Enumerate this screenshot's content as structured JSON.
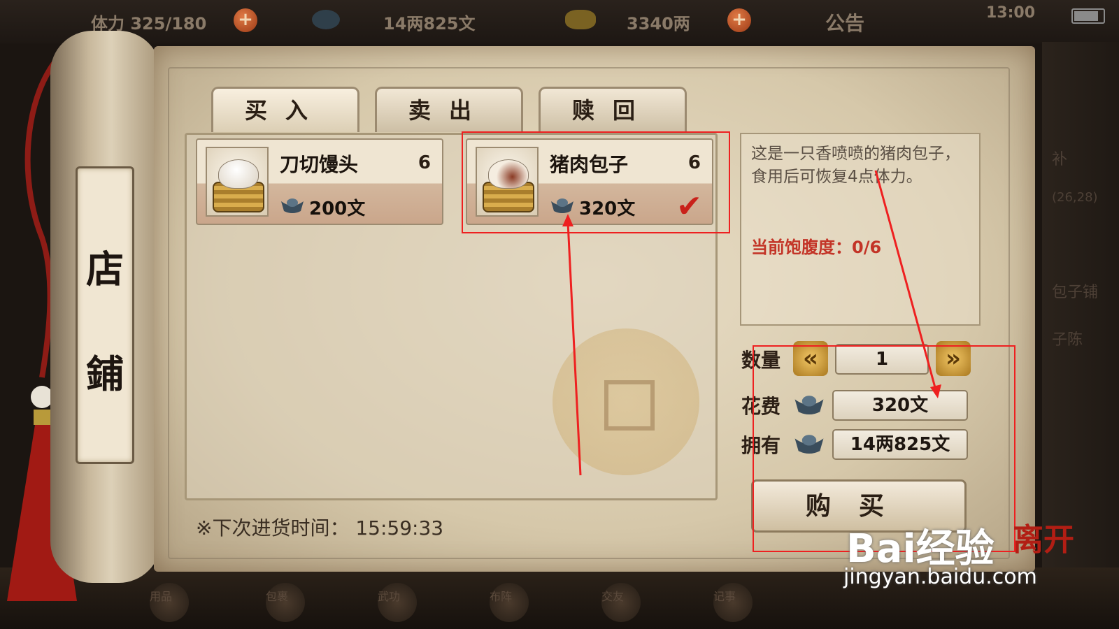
{
  "status_bar": {
    "stamina": "体力 325/180",
    "silver": "14两825文",
    "gold": "3340两",
    "notice": "公告",
    "time": "13:00"
  },
  "scroll": {
    "title_1": "店",
    "title_2": "鋪"
  },
  "tabs": [
    {
      "label": "买入"
    },
    {
      "label": "卖出"
    },
    {
      "label": "赎回"
    }
  ],
  "items": [
    {
      "name": "刀切馒头",
      "count": "6",
      "price": "200文"
    },
    {
      "name": "猪肉包子",
      "count": "6",
      "price": "320文",
      "selected": true
    }
  ],
  "description": {
    "text": "这是一只香喷喷的猪肉包子，食用后可恢复4点体力。",
    "satiety": "当前饱腹度：0/6"
  },
  "purchase": {
    "quantity_label": "数量",
    "quantity": "1",
    "cost_label": "花费",
    "cost": "320文",
    "owned_label": "拥有",
    "owned": "14两825文",
    "buy_label": "购买"
  },
  "restock": "※下次进货时间：  15:59:33",
  "right_strip": [
    "补",
    "(26,28)",
    "包子铺",
    "子陈"
  ],
  "bottom_icons": [
    "用品",
    "包裹",
    "武功",
    "布阵",
    "交友",
    "记事"
  ],
  "watermark": {
    "brand": "Bai经验",
    "url": "jingyan.baidu.com",
    "logo": "离开"
  },
  "colors": {
    "highlight": "#ee2020",
    "satiety": "#c33427",
    "check": "#c9211a"
  }
}
